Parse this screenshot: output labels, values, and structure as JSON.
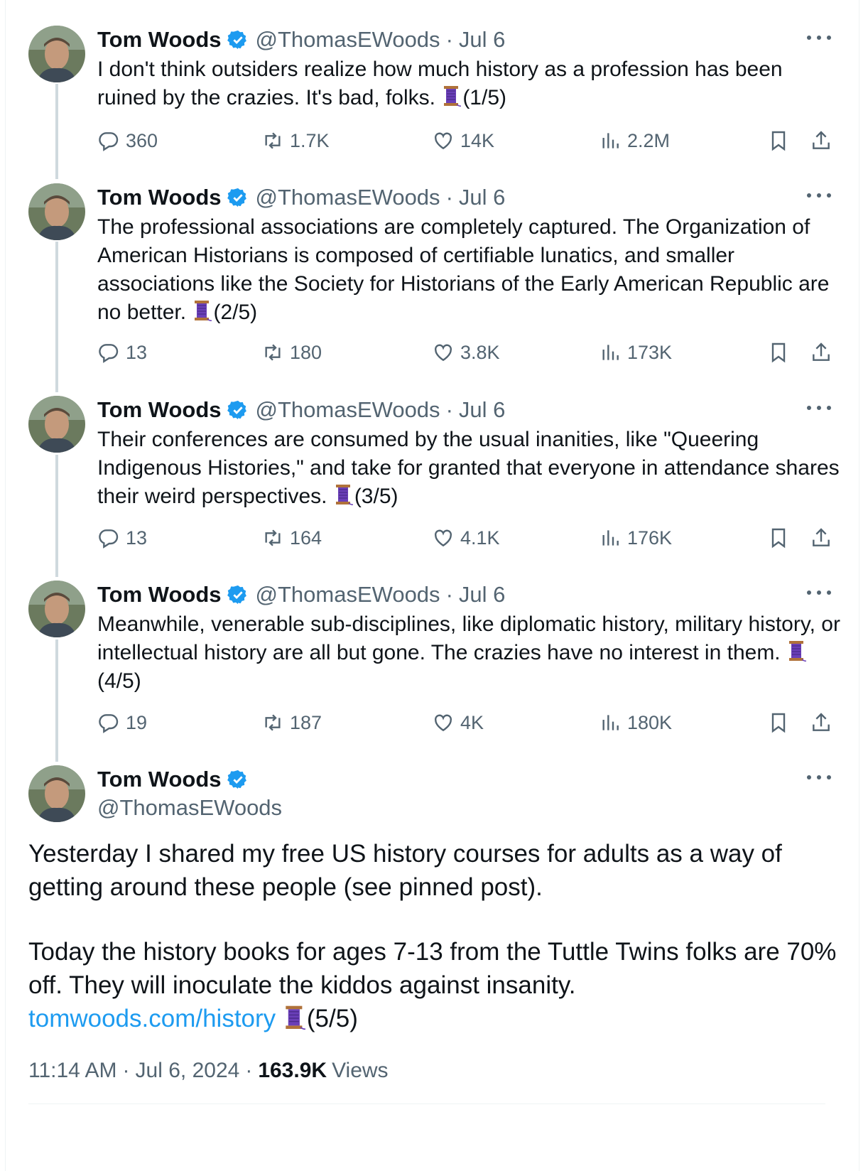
{
  "colors": {
    "text": "#0f1419",
    "secondary": "#536471",
    "link": "#1d9bf0",
    "verified": "#1d9bf0",
    "thread_line": "#cfd9de"
  },
  "icons": {
    "reply": "speech-bubble-icon",
    "repost": "repost-arrows-icon",
    "like": "heart-icon",
    "views": "bar-chart-icon",
    "bookmark": "bookmark-icon",
    "share": "share-upload-icon",
    "thread_emoji": "thread-spool-emoji"
  },
  "author": {
    "name": "Tom Woods",
    "handle": "@ThomasEWoods",
    "separator": "·",
    "date": "Jul 6"
  },
  "tweets": [
    {
      "text": "I don't think outsiders realize how much history as a profession has been ruined by the crazies. It's bad, folks.",
      "counter": "(1/5)",
      "replies": "360",
      "reposts": "1.7K",
      "likes": "14K",
      "views": "2.2M"
    },
    {
      "text": "The professional associations are completely captured. The Organization of American Historians is composed of certifiable lunatics, and smaller associations like the Society for Historians of the Early American Republic are no better.",
      "counter": "(2/5)",
      "replies": "13",
      "reposts": "180",
      "likes": "3.8K",
      "views": "173K"
    },
    {
      "text": "Their conferences are consumed by the usual inanities, like \"Queering Indigenous Histories,\" and take for granted that everyone in attendance shares their weird perspectives.",
      "counter": "(3/5)",
      "replies": "13",
      "reposts": "164",
      "likes": "4.1K",
      "views": "176K"
    },
    {
      "text": "Meanwhile, venerable sub-disciplines, like diplomatic history, military history, or intellectual history are all but gone. The crazies have no interest in them.",
      "counter": "(4/5)",
      "replies": "19",
      "reposts": "187",
      "likes": "4K",
      "views": "180K"
    }
  ],
  "main_tweet": {
    "paragraph1": "Yesterday I shared my free US history courses for adults as a way of getting around these people (see pinned post).",
    "paragraph2": "Today the history books for ages 7-13 from the Tuttle Twins folks are 70% off. They will inoculate the kiddos against insanity.",
    "link": "tomwoods.com/history",
    "counter": "(5/5)",
    "time": "11:14 AM",
    "separator": "·",
    "date": "Jul 6, 2024",
    "views_count": "163.9K",
    "views_label": "Views"
  }
}
